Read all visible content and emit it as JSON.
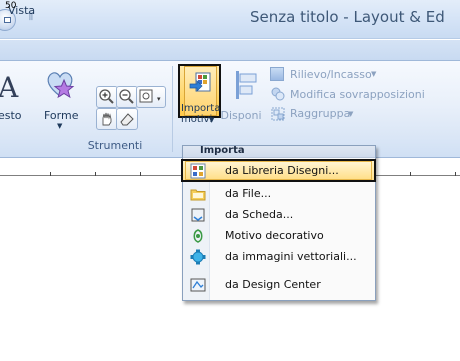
{
  "window": {
    "title": "Senza titolo - Layout & Ed",
    "qat_dropdown_glyph": "⫪"
  },
  "tabs": [
    {
      "label": "Vista"
    }
  ],
  "ribbon": {
    "left_partial_labels": {
      "A_glyph": "A",
      "testo_label": "esto"
    },
    "forme_label": "Forme",
    "strumenti_group_label": "Strumenti",
    "importa_label_line1": "Importa",
    "importa_label_line2": "motivi",
    "disponi_label": "Disponi",
    "rilievo_label": "Rilievo/Incasso",
    "modifica_label": "Modifica sovrapposizioni",
    "raggruppa_label": "Raggruppa"
  },
  "ruler": {
    "label": "50"
  },
  "menu": {
    "header": "Importa",
    "items": [
      {
        "label": "da Libreria Disegni...",
        "icon": "library-icon"
      },
      {
        "label": "da File...",
        "icon": "folder-icon"
      },
      {
        "label": "da Scheda...",
        "icon": "card-icon"
      },
      {
        "label": "Motivo decorativo",
        "icon": "decorative-pattern-icon"
      },
      {
        "label": "da immagini vettoriali...",
        "icon": "vector-image-icon"
      },
      {
        "label": "da Design Center",
        "icon": "design-center-icon"
      }
    ]
  },
  "colors": {
    "ribbon_bg": "#dae6f6",
    "highlight": "#ffd66b",
    "text": "#1e395b"
  }
}
